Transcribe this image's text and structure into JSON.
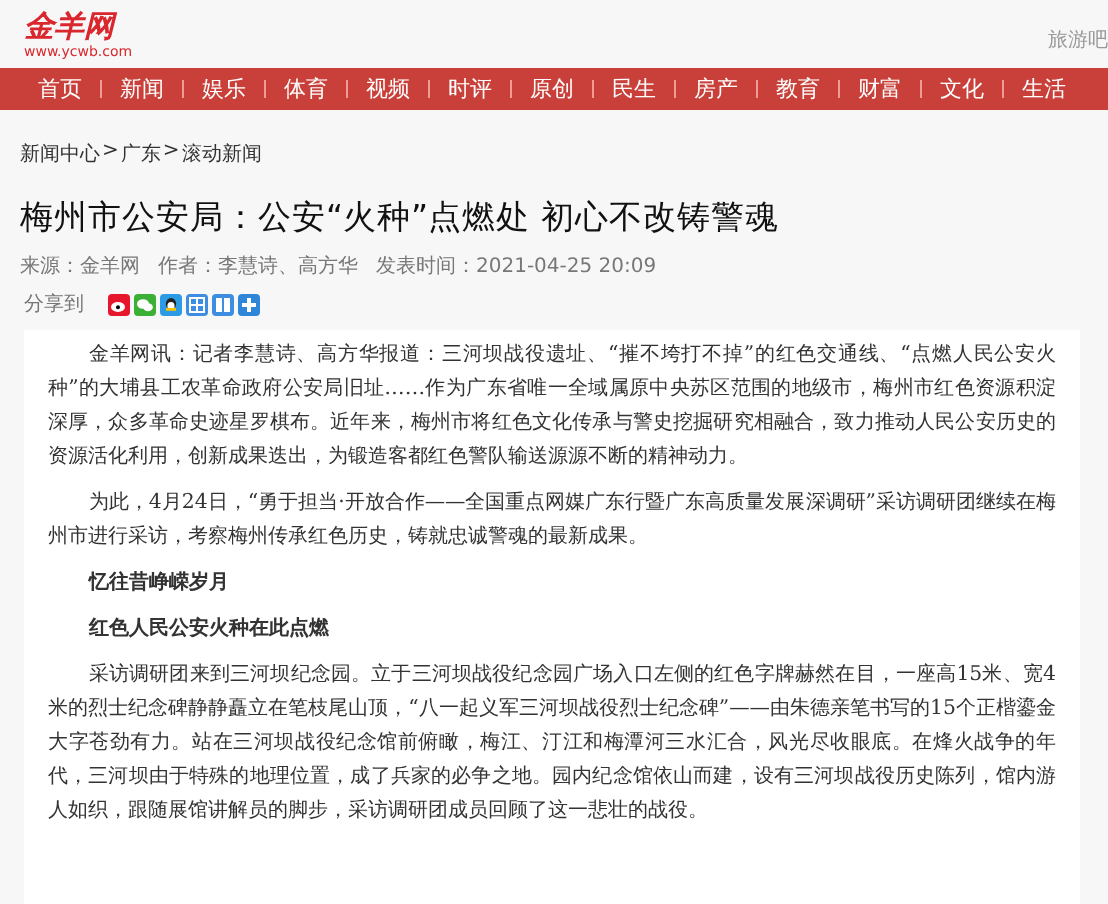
{
  "header": {
    "logo": "金羊网",
    "logo_url": "www.ycwb.com",
    "top_link": "旅游吧"
  },
  "nav": [
    "首页",
    "新闻",
    "娱乐",
    "体育",
    "视频",
    "时评",
    "原创",
    "民生",
    "房产",
    "教育",
    "财富",
    "文化",
    "生活"
  ],
  "breadcrumb": [
    "新闻中心",
    "广东",
    "滚动新闻"
  ],
  "breadcrumb_separator": ">",
  "article": {
    "title": "梅州市公安局：公安“火种”点燃处 初心不改铸警魂",
    "meta": [
      "来源：金羊网",
      "作者：李慧诗、高方华",
      "发表时间：2021-04-25 20:09"
    ],
    "share_label": "分享到",
    "share_icons": [
      {
        "kind": "weibo",
        "color": "#e6162d"
      },
      {
        "kind": "wechat",
        "color": "#3cb034"
      },
      {
        "kind": "qq",
        "color": "#2b9be6"
      },
      {
        "kind": "grid",
        "color": "#3d8ee0"
      },
      {
        "kind": "tieba",
        "color": "#3d8ee0"
      },
      {
        "kind": "plus",
        "color": "#2f86d8"
      }
    ],
    "body": [
      {
        "kind": "paragraph",
        "text": "金羊网讯：记者李慧诗、高方华报道：三河坝战役遗址、“摧不垮打不掉”的红色交通线、“点燃人民公安火种”的大埔县工农革命政府公安局旧址……作为广东省唯一全域属原中央苏区范围的地级市，梅州市红色资源积淀深厚，众多革命史迹星罗棋布。近年来，梅州市将红色文化传承与警史挖掘研究相融合，致力推动人民公安历史的资源活化利用，创新成果迭出，为锻造客都红色警队输送源源不断的精神动力。"
      },
      {
        "kind": "paragraph",
        "text": "为此，4月24日，“勇于担当·开放合作——全国重点网媒广东行暨广东高质量发展深调研”采访调研团继续在梅州市进行采访，考察梅州传承红色历史，铸就忠诚警魂的最新成果。"
      },
      {
        "kind": "heading",
        "text": "忆往昔峥嵘岁月"
      },
      {
        "kind": "heading",
        "text": "红色人民公安火种在此点燃"
      },
      {
        "kind": "paragraph",
        "text": "采访调研团来到三河坝纪念园。立于三河坝战役纪念园广场入口左侧的红色字牌赫然在目，一座高15米、宽4米的烈士纪念碑静静矗立在笔枝尾山顶，“八一起义军三河坝战役烈士纪念碑”——由朱德亲笔书写的15个正楷鎏金大字苍劲有力。站在三河坝战役纪念馆前俯瞰，梅江、汀江和梅潭河三水汇合，风光尽收眼底。在烽火战争的年代，三河坝由于特殊的地理位置，成了兵家的必争之地。园内纪念馆依山而建，设有三河坝战役历史陈列，馆内游人如织，跟随展馆讲解员的脚步，采访调研团成员回顾了这一悲壮的战役。"
      }
    ]
  }
}
